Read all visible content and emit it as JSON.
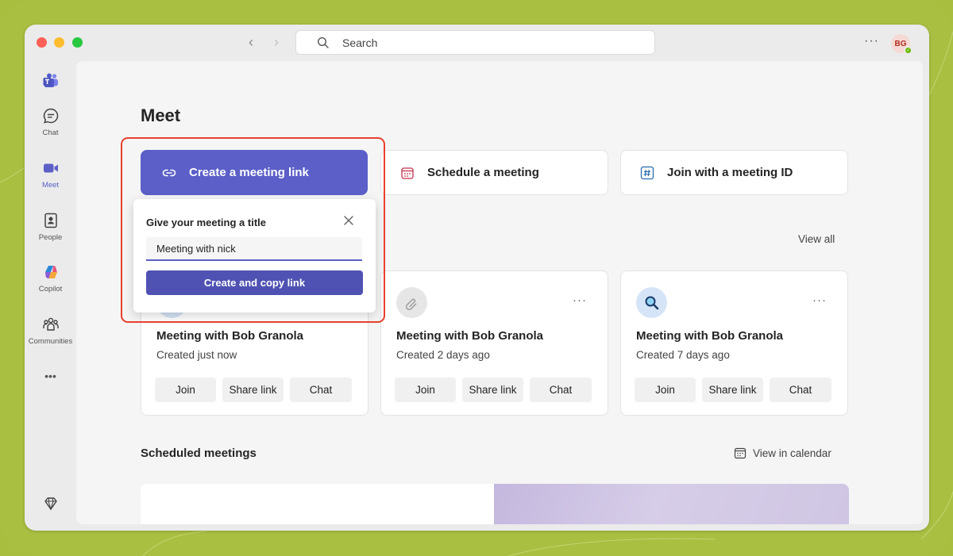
{
  "window": {
    "search_placeholder": "Search",
    "user_initials": "BG"
  },
  "rail": {
    "items": [
      {
        "label": "",
        "icon": "teams-logo-icon"
      },
      {
        "label": "Chat",
        "icon": "chat-icon"
      },
      {
        "label": "Meet",
        "icon": "video-camera-icon",
        "active": true
      },
      {
        "label": "People",
        "icon": "person-card-icon"
      },
      {
        "label": "Copilot",
        "icon": "copilot-icon"
      },
      {
        "label": "Communities",
        "icon": "communities-icon"
      }
    ],
    "more": "•••"
  },
  "page": {
    "title": "Meet"
  },
  "actions": {
    "create_link": "Create a meeting link",
    "schedule": "Schedule a meeting",
    "join_id": "Join with a meeting ID"
  },
  "popup": {
    "title": "Give your meeting a title",
    "input_value": "Meeting with nick",
    "button": "Create and copy link"
  },
  "recent": {
    "view_all": "View all",
    "cards": [
      {
        "name": "Meeting with Bob Granola",
        "created": "Created just now",
        "join": "Join",
        "share": "Share link",
        "chat": "Chat"
      },
      {
        "name": "Meeting with Bob Granola",
        "created": "Created 2 days ago",
        "join": "Join",
        "share": "Share link",
        "chat": "Chat"
      },
      {
        "name": "Meeting with Bob Granola",
        "created": "Created 7 days ago",
        "join": "Join",
        "share": "Share link",
        "chat": "Chat"
      }
    ]
  },
  "scheduled": {
    "title": "Scheduled meetings",
    "view_calendar": "View in calendar"
  },
  "colors": {
    "accent": "#5b5fc7",
    "highlight": "#e8402e",
    "background": "#a9bf42"
  }
}
